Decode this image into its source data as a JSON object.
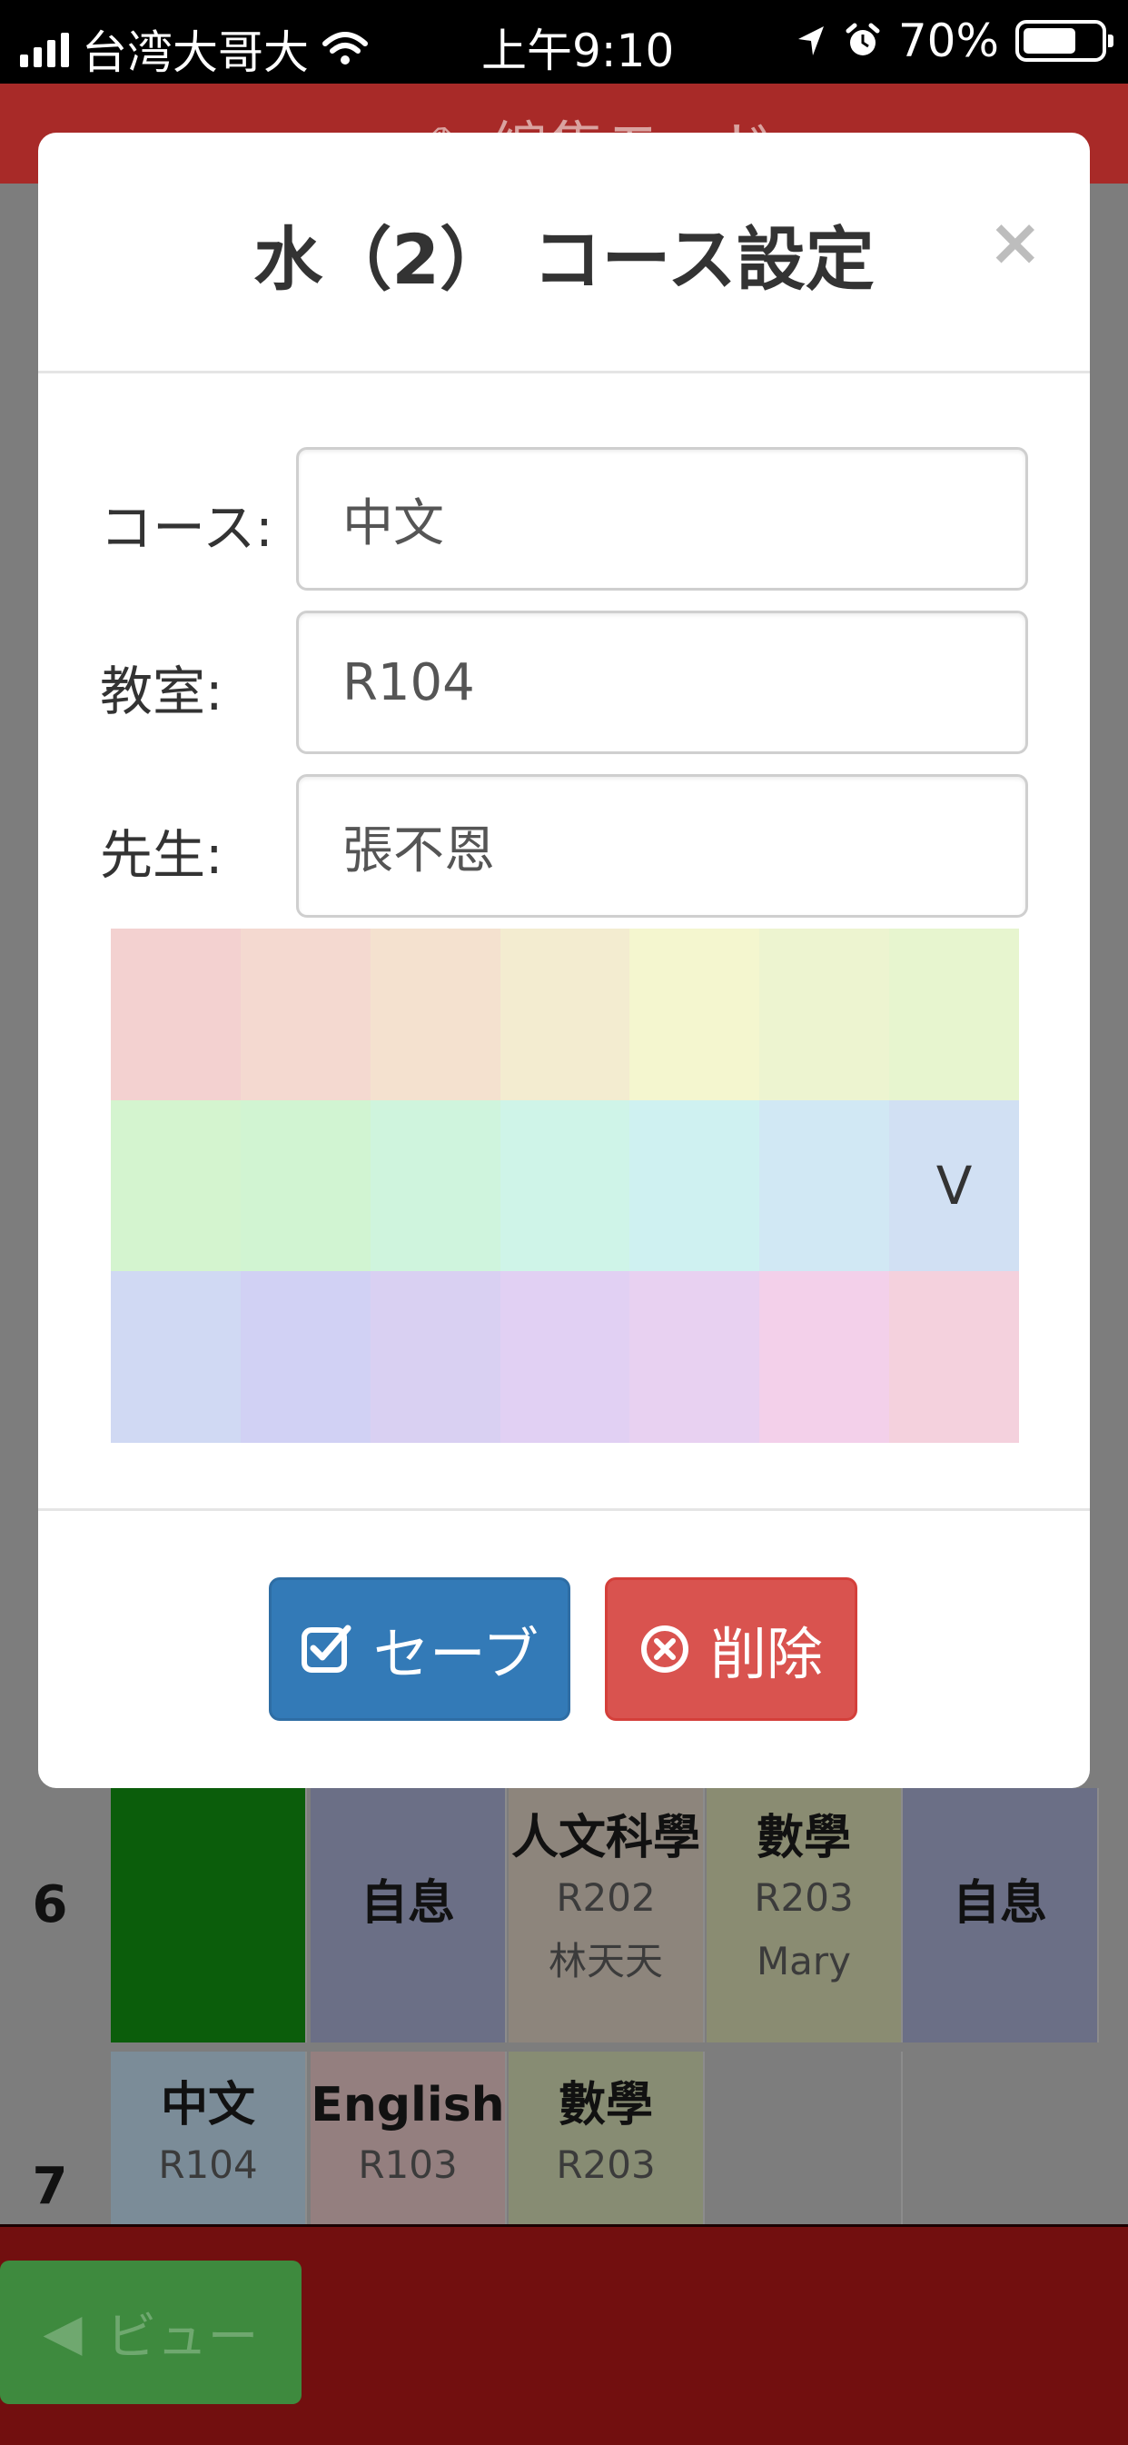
{
  "status_bar": {
    "carrier": "台湾大哥大",
    "time": "上午9:10",
    "battery": "70%",
    "battery_level": 0.7
  },
  "background": {
    "header_title": "編集モード",
    "rows": [
      {
        "label": "6",
        "cells": [
          {
            "title": "",
            "room": "",
            "teacher": "",
            "color": "#0b5d0b"
          },
          {
            "title": "自息",
            "room": "",
            "teacher": "",
            "color": "#6b6f86"
          },
          {
            "title": "人文科學",
            "room": "R202",
            "teacher": "林天天",
            "color": "#8d857c"
          },
          {
            "title": "數學",
            "room": "R203",
            "teacher": "Mary",
            "color": "#8a8c72"
          },
          {
            "title": "自息",
            "room": "",
            "teacher": "",
            "color": "#6b6f86"
          }
        ]
      },
      {
        "label": "7",
        "cells": [
          {
            "title": "中文",
            "room": "R104",
            "teacher": "",
            "color": "#7b8c98"
          },
          {
            "title": "English",
            "room": "R103",
            "teacher": "",
            "color": "#947f7f"
          },
          {
            "title": "數學",
            "room": "R203",
            "teacher": "",
            "color": "#878c73"
          },
          {
            "title": "",
            "room": "",
            "teacher": "",
            "color": "#7d7d7d"
          }
        ]
      }
    ],
    "view_button": "ビュー"
  },
  "modal": {
    "title": "水（2） コース設定",
    "close": "×",
    "fields": {
      "course_label": "コース:",
      "course_value": "中文",
      "room_label": "教室:",
      "room_value": "R104",
      "teacher_label": "先生:",
      "teacher_value": "張不恩"
    },
    "palette": [
      {
        "color": "#f3d1d0",
        "selected": false
      },
      {
        "color": "#f4d9d0",
        "selected": false
      },
      {
        "color": "#f4e1cf",
        "selected": false
      },
      {
        "color": "#f3ecd0",
        "selected": false
      },
      {
        "color": "#f4f6cf",
        "selected": false
      },
      {
        "color": "#edf4d0",
        "selected": false
      },
      {
        "color": "#e7f5cf",
        "selected": false
      },
      {
        "color": "#d4f4cf",
        "selected": false
      },
      {
        "color": "#d1f4d2",
        "selected": false
      },
      {
        "color": "#cff4dd",
        "selected": false
      },
      {
        "color": "#cff4e8",
        "selected": false
      },
      {
        "color": "#cff1f1",
        "selected": false
      },
      {
        "color": "#d1e8f4",
        "selected": false
      },
      {
        "color": "#d1e0f3",
        "selected": true,
        "mark": "V"
      },
      {
        "color": "#d0d9f3",
        "selected": false
      },
      {
        "color": "#d1d1f4",
        "selected": false
      },
      {
        "color": "#d9d0f2",
        "selected": false
      },
      {
        "color": "#e1d0f3",
        "selected": false
      },
      {
        "color": "#e8d1f1",
        "selected": false
      },
      {
        "color": "#f3d0ea",
        "selected": false
      },
      {
        "color": "#f4d1dd",
        "selected": false
      }
    ],
    "save_button": "セーブ",
    "delete_button": "削除"
  }
}
